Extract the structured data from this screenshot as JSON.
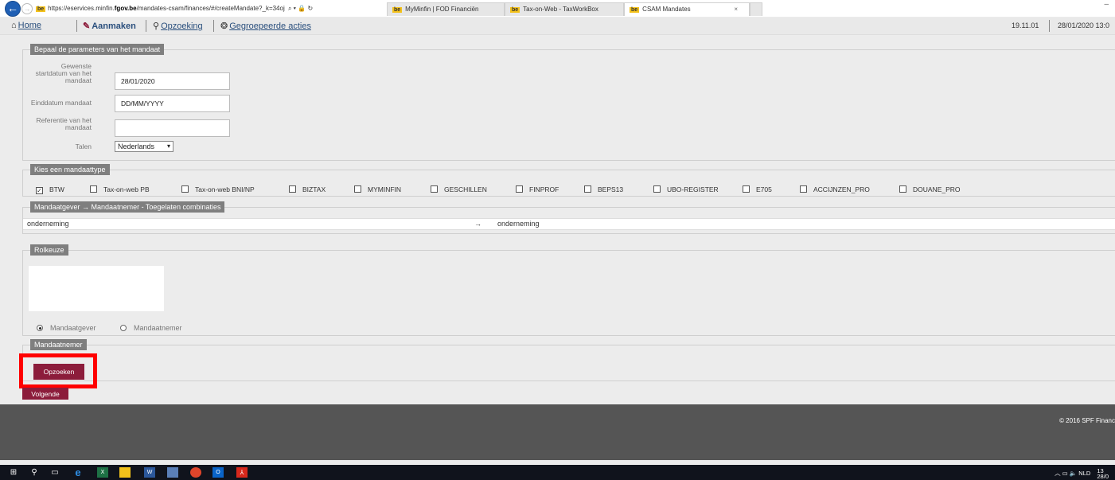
{
  "browser": {
    "url_prefix": "https://eservices.minfin.",
    "url_host": "fgov.be",
    "url_rest": "/mandates-csam/finances/#/createMandate?_k=34oj",
    "url_icons": "⌕ ▾ 🔒 ↻",
    "favicon_label": "be",
    "tabs": [
      {
        "label": "MyMinfin | FOD Financiën"
      },
      {
        "label": "Tax-on-Web - TaxWorkBox"
      },
      {
        "label": "CSAM Mandates"
      }
    ],
    "tab_close": "×",
    "back_icon": "arrow-left",
    "forward_icon": "arrow-right",
    "minimize": "–"
  },
  "menu": {
    "home": "Home",
    "create": "Aanmaken",
    "search": "Opzoeking",
    "group": "Gegroepeerde acties",
    "version": "19.11.01",
    "datetime": "28/01/2020 13:0"
  },
  "params": {
    "legend": "Bepaal de parameters van het mandaat",
    "start_label": "Gewenste startdatum van het mandaat",
    "start_value": "28/01/2020",
    "end_label": "Einddatum mandaat",
    "end_value": "DD/MM/YYYY",
    "ref_label": "Referentie van het mandaat",
    "ref_value": "",
    "lang_label": "Talen",
    "lang_value": "Nederlands"
  },
  "types": {
    "legend": "Kies een mandaattype",
    "items": [
      {
        "label": "BTW",
        "checked": true
      },
      {
        "label": "Tax-on-web PB",
        "checked": false
      },
      {
        "label": "Tax-on-web BNI/NP",
        "checked": false
      },
      {
        "label": "BIZTAX",
        "checked": false
      },
      {
        "label": "MYMINFIN",
        "checked": false
      },
      {
        "label": "GESCHILLEN",
        "checked": false
      },
      {
        "label": "FINPROF",
        "checked": false
      },
      {
        "label": "BEPS13",
        "checked": false
      },
      {
        "label": "UBO-REGISTER",
        "checked": false
      },
      {
        "label": "E705",
        "checked": false
      },
      {
        "label": "ACCIJNZEN_PRO",
        "checked": false
      },
      {
        "label": "DOUANE_PRO",
        "checked": false
      }
    ]
  },
  "combos": {
    "legend": "Mandaatgever → Mandaatnemer - Toegelaten combinaties",
    "from": "onderneming",
    "arrow": "→",
    "to": "onderneming"
  },
  "role": {
    "legend": "Rolkeuze",
    "option1": "Mandaatgever",
    "option2": "Mandaatnemer",
    "selected": "Mandaatgever"
  },
  "taker": {
    "legend": "Mandaatnemer",
    "search_button": "Opzoeken"
  },
  "next_button": "Volgende",
  "footer": {
    "copyright": "© 2016 SPF Financ"
  },
  "taskbar": {
    "tray_lang": "NLD",
    "tray_time": "13",
    "tray_date": "28/0"
  },
  "colors": {
    "accent": "#8c1c3b",
    "highlight": "#ff0000",
    "legend_bg": "#7f7f7f"
  }
}
